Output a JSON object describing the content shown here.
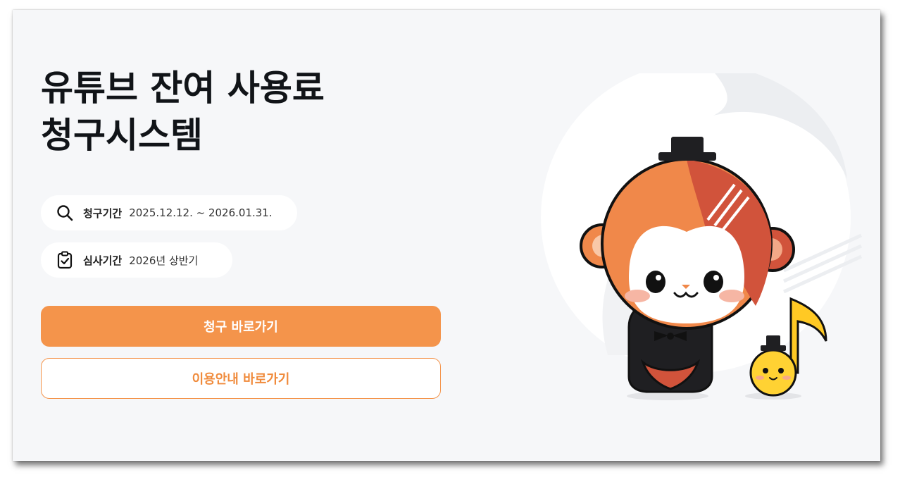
{
  "hero": {
    "title_line1": "유튜브 잔여 사용료",
    "title_line2": "청구시스템"
  },
  "info": [
    {
      "icon": "search-icon",
      "label": "청구기간",
      "value": "2025.12.12. ~ 2026.01.31."
    },
    {
      "icon": "clipboard-check-icon",
      "label": "심사기간",
      "value": "2026년 상반기"
    }
  ],
  "buttons": {
    "claim": "청구 바로가기",
    "guide": "이용안내 바로가기"
  },
  "colors": {
    "accent": "#f4944b",
    "title": "#111418",
    "background": "#f6f7f9"
  }
}
